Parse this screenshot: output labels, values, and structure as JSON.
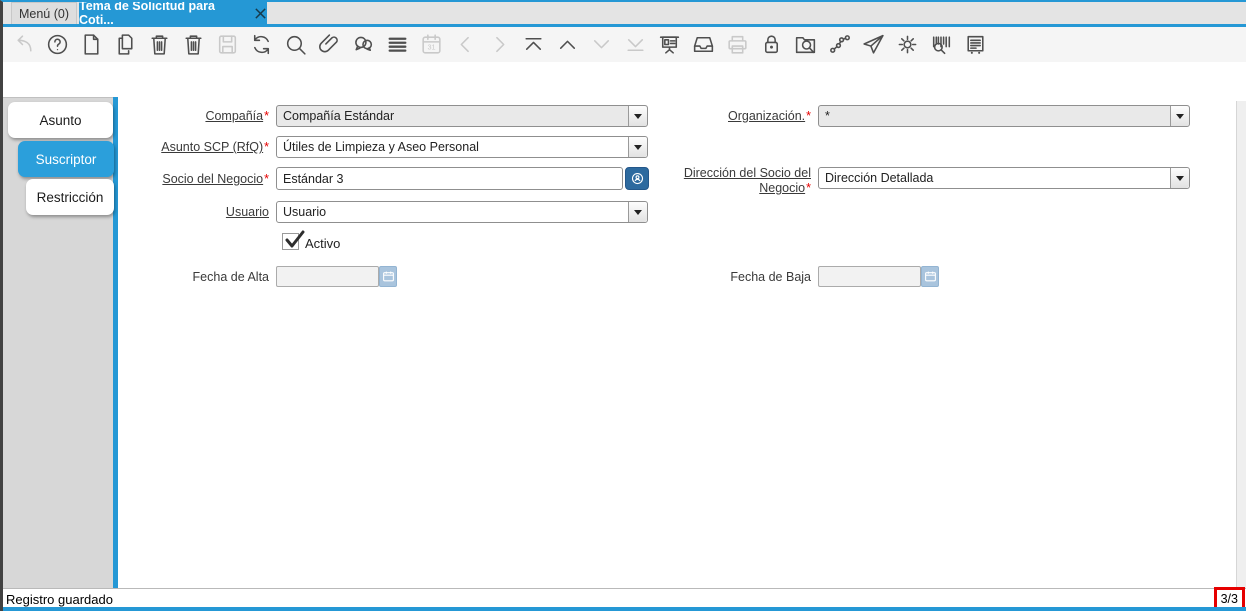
{
  "tabs": {
    "menu": {
      "label": "Menú (0)"
    },
    "active": {
      "label": "Tema de Solicitud para Coti..."
    }
  },
  "toolbar": {
    "items": [
      {
        "icon": "undo",
        "enabled": false
      },
      {
        "icon": "help",
        "enabled": true
      },
      {
        "icon": "new-record",
        "enabled": true
      },
      {
        "icon": "copy-record",
        "enabled": true
      },
      {
        "icon": "delete-record",
        "enabled": true
      },
      {
        "icon": "delete-selection",
        "enabled": true
      },
      {
        "icon": "save",
        "enabled": false
      },
      {
        "icon": "refresh",
        "enabled": true
      },
      {
        "icon": "find",
        "enabled": true
      },
      {
        "icon": "attachment",
        "enabled": true
      },
      {
        "icon": "chat",
        "enabled": true
      },
      {
        "icon": "grid-view",
        "enabled": true
      },
      {
        "icon": "calendar",
        "enabled": false
      },
      {
        "icon": "parent-record",
        "enabled": false
      },
      {
        "icon": "detail-record",
        "enabled": false
      },
      {
        "icon": "first-record",
        "enabled": true
      },
      {
        "icon": "previous-record",
        "enabled": true
      },
      {
        "icon": "next-record",
        "enabled": false
      },
      {
        "icon": "last-record",
        "enabled": false
      },
      {
        "icon": "report",
        "enabled": true
      },
      {
        "icon": "archive",
        "enabled": true
      },
      {
        "icon": "print",
        "enabled": false
      },
      {
        "icon": "lock",
        "enabled": true
      },
      {
        "icon": "zoom-across",
        "enabled": true
      },
      {
        "icon": "workflow",
        "enabled": true
      },
      {
        "icon": "send-mail",
        "enabled": true
      },
      {
        "icon": "settings",
        "enabled": true
      },
      {
        "icon": "barcode-scan",
        "enabled": true
      },
      {
        "icon": "print-preview",
        "enabled": true
      }
    ]
  },
  "sidebar": {
    "tabs": [
      {
        "label": "Asunto",
        "selected": false
      },
      {
        "label": "Suscriptor",
        "selected": true
      },
      {
        "label": "Restricción",
        "selected": false
      }
    ]
  },
  "form": {
    "required_marker": "*",
    "fields": {
      "compania": {
        "label": "Compañía",
        "required": true,
        "value": "Compañía Estándar"
      },
      "organizacion": {
        "label": "Organización.",
        "required": true,
        "value": "*"
      },
      "asunto_scp": {
        "label": "Asunto SCP (RfQ)",
        "required": true,
        "value": "Útiles de Limpieza y Aseo Personal"
      },
      "socio_negocio": {
        "label": "Socio del Negocio",
        "required": true,
        "value": "Estándar 3"
      },
      "direccion_socio": {
        "label": "Dirección del Socio del Negocio",
        "required": true,
        "value": "Dirección Detallada"
      },
      "usuario": {
        "label": "Usuario",
        "required": false,
        "value": "Usuario"
      },
      "activo": {
        "label": "Activo",
        "checked": true
      },
      "fecha_alta": {
        "label": "Fecha de Alta",
        "value": ""
      },
      "fecha_baja": {
        "label": "Fecha de Baja",
        "value": ""
      }
    }
  },
  "statusbar": {
    "message": "Registro guardado",
    "record_indicator": "3/3"
  },
  "colors": {
    "accent": "#2598d5",
    "selected_tab": "#2b9fdb",
    "required": "#e60000",
    "info_button": "#2d6a9f",
    "date_button": "#a9c4dd",
    "annotation_box": "#e60000"
  }
}
